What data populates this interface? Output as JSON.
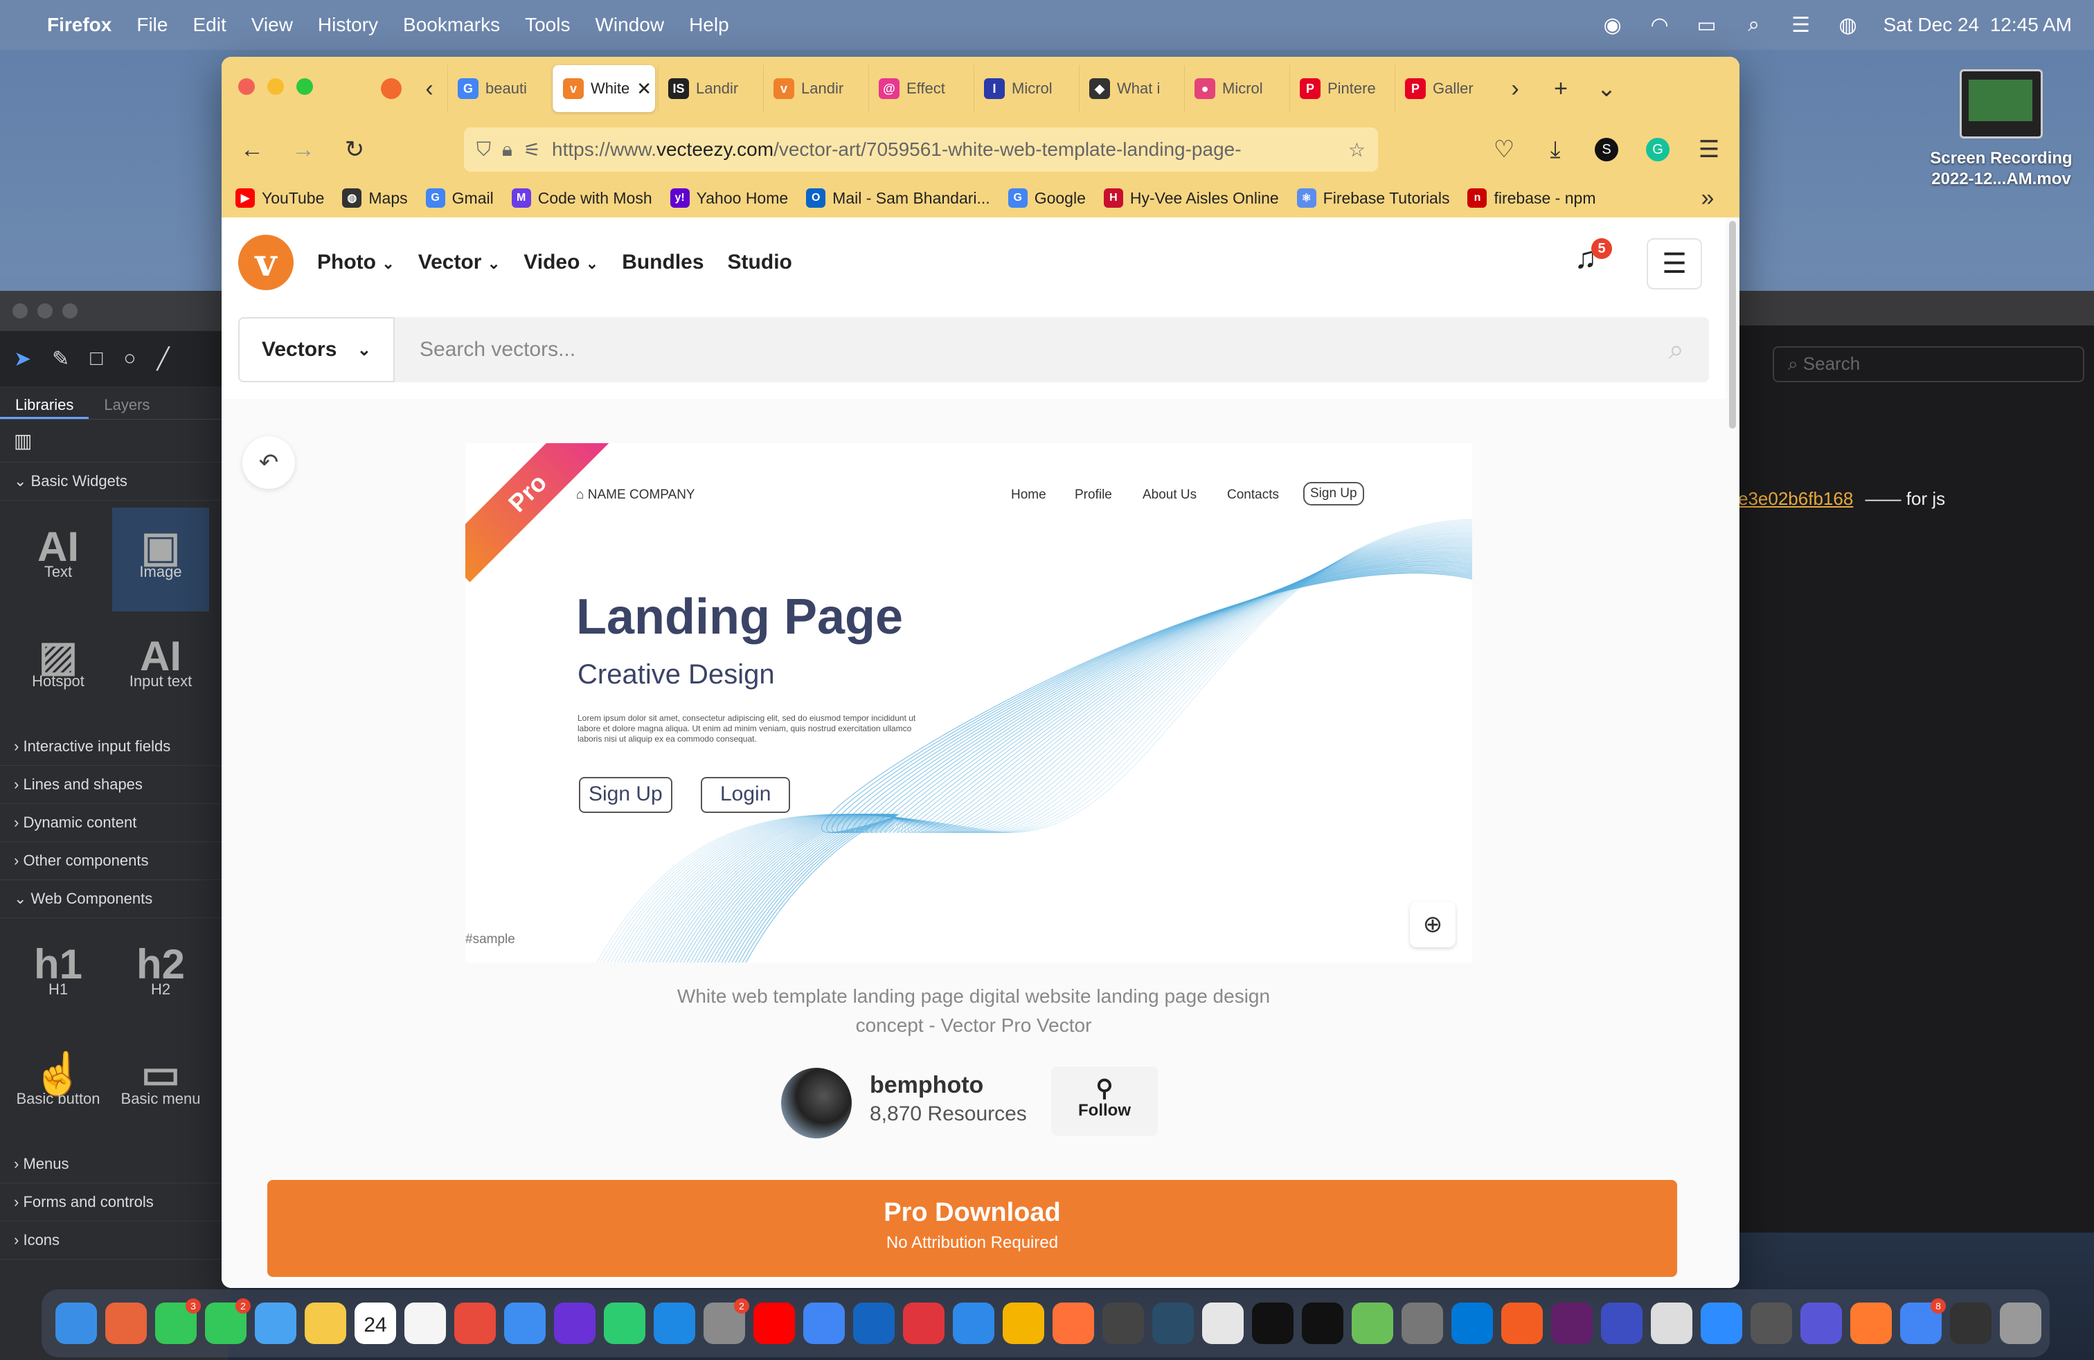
{
  "menubar": {
    "app": "Firefox",
    "items": [
      "File",
      "Edit",
      "View",
      "History",
      "Bookmarks",
      "Tools",
      "Window",
      "Help"
    ],
    "datetime": "Sat Dec 24  12:45 AM"
  },
  "desktop": {
    "file_label": "Screen Recording 2022-12...AM.mov"
  },
  "design_app": {
    "tabs": [
      "Libraries",
      "Layers"
    ],
    "sections": {
      "basic_widgets": "Basic Widgets",
      "interactive": "Interactive input fields",
      "lines": "Lines and shapes",
      "dynamic": "Dynamic content",
      "other": "Other components",
      "web": "Web Components",
      "menus": "Menus",
      "forms": "Forms and controls",
      "icons": "Icons"
    },
    "widgets": [
      {
        "icon": "AI",
        "label": "Text"
      },
      {
        "icon": "▣",
        "label": "Image"
      },
      {
        "icon": "▨",
        "label": "Hotspot"
      },
      {
        "icon": "AI",
        "label": "Input text"
      }
    ],
    "web_widgets": [
      {
        "icon": "h1",
        "label": "H1"
      },
      {
        "icon": "h2",
        "label": "H2"
      },
      {
        "icon": "☝",
        "label": "Basic button"
      },
      {
        "icon": "▭",
        "label": "Basic menu"
      }
    ]
  },
  "terminal": {
    "search_placeholder": "Search",
    "hash_link": "e3e02b6fb168",
    "note": "—— for js"
  },
  "browser": {
    "tabs": [
      {
        "label": "beauti",
        "color": "#4285f4",
        "glyph": "G"
      },
      {
        "label": "White",
        "color": "#f0812a",
        "glyph": "v",
        "active": true
      },
      {
        "label": "Landir",
        "color": "#222222",
        "glyph": "IS"
      },
      {
        "label": "Landir",
        "color": "#f0812a",
        "glyph": "v"
      },
      {
        "label": "Effect",
        "color": "#e8388f",
        "glyph": "@"
      },
      {
        "label": "Microl",
        "color": "#2a3aa8",
        "glyph": "I"
      },
      {
        "label": "What i",
        "color": "#333333",
        "glyph": "◆"
      },
      {
        "label": "Microl",
        "color": "#e4437a",
        "glyph": "●"
      },
      {
        "label": "Pintere",
        "color": "#e60023",
        "glyph": "P"
      },
      {
        "label": "Galler",
        "color": "#e60023",
        "glyph": "P"
      }
    ],
    "url_prefix": "https://www.",
    "url_domain": "vecteezy.com",
    "url_path": "/vector-art/7059561-white-web-template-landing-page-",
    "bookmarks": [
      {
        "label": "YouTube",
        "color": "#ff0000",
        "glyph": "▶"
      },
      {
        "label": "Maps",
        "color": "#333333",
        "glyph": "◍"
      },
      {
        "label": "Gmail",
        "color": "#4285f4",
        "glyph": "G"
      },
      {
        "label": "Code with Mosh",
        "color": "#6a3de8",
        "glyph": "M"
      },
      {
        "label": "Yahoo Home",
        "color": "#5f01d1",
        "glyph": "y!"
      },
      {
        "label": "Mail - Sam Bhandari...",
        "color": "#0a64c8",
        "glyph": "O"
      },
      {
        "label": "Google",
        "color": "#4285f4",
        "glyph": "G"
      },
      {
        "label": "Hy-Vee Aisles Online",
        "color": "#c8102e",
        "glyph": "H"
      },
      {
        "label": "Firebase Tutorials",
        "color": "#5b8def",
        "glyph": "⚛"
      },
      {
        "label": "firebase - npm",
        "color": "#cb0000",
        "glyph": "n"
      }
    ]
  },
  "site": {
    "logo_glyph": "v",
    "nav": [
      {
        "label": "Photo",
        "caret": "⌄"
      },
      {
        "label": "Vector",
        "caret": "⌄"
      },
      {
        "label": "Video",
        "caret": "⌄"
      },
      {
        "label": "Bundles",
        "caret": ""
      },
      {
        "label": "Studio",
        "caret": ""
      }
    ],
    "notification_count": "5",
    "search_category": "Vectors",
    "search_placeholder": "Search vectors...",
    "preview": {
      "ribbon": "Pro",
      "brand": "NAME COMPANY",
      "nav": [
        "Home",
        "Profile",
        "About Us",
        "Contacts"
      ],
      "signup_pill": "Sign Up",
      "title": "Landing Page",
      "subtitle": "Creative Design",
      "lorem": "Lorem ipsum dolor sit amet, consectetur adipiscing elit, sed do eiusmod tempor incididunt ut labore et dolore magna aliqua. Ut enim ad minim veniam, quis nostrud exercitation ullamco laboris nisi ut aliquip ex ea commodo consequat.",
      "btn_signup": "Sign Up",
      "btn_login": "Login",
      "tag": "#sample"
    },
    "description": "White web template landing page digital website landing page design concept - Vector Pro Vector",
    "author": {
      "name": "bemphoto",
      "resources": "8,870 Resources",
      "follow": "Follow"
    },
    "download": {
      "title": "Pro Download",
      "subtitle": "No Attribution Required"
    }
  },
  "dock": {
    "apps": [
      {
        "color": "#3b8ee6"
      },
      {
        "color": "#e8643a"
      },
      {
        "color": "#34c759",
        "badge": "3"
      },
      {
        "color": "#34c759",
        "badge": "2"
      },
      {
        "color": "#4aa3f0"
      },
      {
        "color": "#f7c948"
      },
      {
        "color": "#ffffff"
      },
      {
        "color": "#f5f5f5"
      },
      {
        "color": "#e84a3c"
      },
      {
        "color": "#3d8ef0"
      },
      {
        "color": "#6a31d6"
      },
      {
        "color": "#2ecc71"
      },
      {
        "color": "#1e88e5"
      },
      {
        "color": "#8a8a8a",
        "badge": "2"
      },
      {
        "color": "#ff0000"
      },
      {
        "color": "#4285f4"
      },
      {
        "color": "#1565c0"
      },
      {
        "color": "#e0353d"
      },
      {
        "color": "#2f89e8"
      },
      {
        "color": "#f4b400"
      },
      {
        "color": "#ff7139"
      },
      {
        "color": "#444444"
      },
      {
        "color": "#2a4d69"
      },
      {
        "color": "#e6e6e6"
      },
      {
        "color": "#111111"
      },
      {
        "color": "#111111"
      },
      {
        "color": "#6bbf59"
      },
      {
        "color": "#777777"
      },
      {
        "color": "#0078d7"
      },
      {
        "color": "#f45d22"
      },
      {
        "color": "#611f69"
      },
      {
        "color": "#3c4ec2"
      },
      {
        "color": "#dddddd"
      },
      {
        "color": "#2d8cff"
      },
      {
        "color": "#555555"
      },
      {
        "color": "#5856d6"
      },
      {
        "color": "#ff7a2f"
      },
      {
        "color": "#4285f4",
        "badge": "8"
      },
      {
        "color": "#333333"
      },
      {
        "color": "#999999"
      }
    ],
    "calendar_day": "24"
  }
}
